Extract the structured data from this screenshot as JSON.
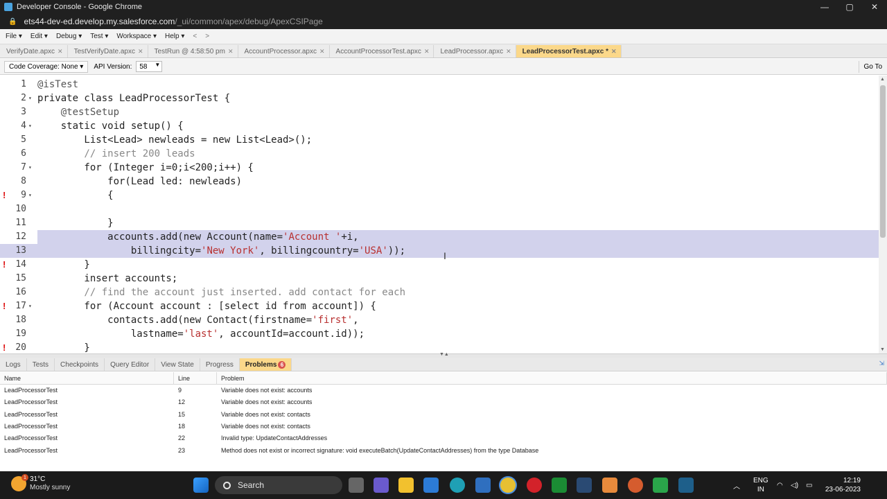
{
  "window": {
    "title": "Developer Console - Google Chrome"
  },
  "url": {
    "host": "ets44-dev-ed.develop.my.salesforce.com",
    "path": "/_ui/common/apex/debug/ApexCSIPage"
  },
  "menu": {
    "items": [
      "File ▾",
      "Edit ▾",
      "Debug ▾",
      "Test ▾",
      "Workspace ▾",
      "Help ▾"
    ],
    "back": "<",
    "forward": ">"
  },
  "tabs": [
    {
      "label": "VerifyDate.apxc",
      "active": false
    },
    {
      "label": "TestVerifyDate.apxc",
      "active": false
    },
    {
      "label": "TestRun @ 4:58:50 pm",
      "active": false
    },
    {
      "label": "AccountProcessor.apxc",
      "active": false
    },
    {
      "label": "AccountProcessorTest.apxc",
      "active": false
    },
    {
      "label": "LeadProcessor.apxc",
      "active": false
    },
    {
      "label": "LeadProcessorTest.apxc *",
      "active": true
    }
  ],
  "toolbar": {
    "code_coverage": "Code Coverage: None ▾",
    "api_label": "API Version:",
    "api_value": "58",
    "goto": "Go To"
  },
  "code": [
    {
      "n": "1",
      "err": "",
      "fold": "",
      "text": "@isTest"
    },
    {
      "n": "2",
      "err": "",
      "fold": "▾",
      "text": "private class LeadProcessorTest {"
    },
    {
      "n": "3",
      "err": "",
      "fold": "",
      "text": "    @testSetup"
    },
    {
      "n": "4",
      "err": "",
      "fold": "▾",
      "text": "    static void setup() {"
    },
    {
      "n": "5",
      "err": "",
      "fold": "",
      "text": "        List<Lead> newleads = new List<Lead>();"
    },
    {
      "n": "6",
      "err": "",
      "fold": "",
      "text": "        // insert 200 leads"
    },
    {
      "n": "7",
      "err": "",
      "fold": "▾",
      "text": "        for (Integer i=0;i<200;i++) {"
    },
    {
      "n": "8",
      "err": "",
      "fold": "",
      "text": "            for(Lead led: newleads)"
    },
    {
      "n": "9",
      "err": "!",
      "fold": "▾",
      "text": "            {"
    },
    {
      "n": "10",
      "err": "",
      "fold": "",
      "text": ""
    },
    {
      "n": "11",
      "err": "",
      "fold": "",
      "text": "            }"
    },
    {
      "n": "12",
      "err": "",
      "fold": "",
      "text": "            accounts.add(new Account(name='Account '+i,"
    },
    {
      "n": "13",
      "err": "",
      "fold": "",
      "text": "                billingcity='New York', billingcountry='USA'));"
    },
    {
      "n": "14",
      "err": "!",
      "fold": "",
      "text": "        }"
    },
    {
      "n": "15",
      "err": "",
      "fold": "",
      "text": "        insert accounts;"
    },
    {
      "n": "16",
      "err": "",
      "fold": "",
      "text": "        // find the account just inserted. add contact for each"
    },
    {
      "n": "17",
      "err": "!",
      "fold": "▾",
      "text": "        for (Account account : [select id from account]) {"
    },
    {
      "n": "18",
      "err": "",
      "fold": "",
      "text": "            contacts.add(new Contact(firstname='first',"
    },
    {
      "n": "19",
      "err": "",
      "fold": "",
      "text": "                lastname='last', accountId=account.id));"
    },
    {
      "n": "20",
      "err": "!",
      "fold": "",
      "text": "        }"
    }
  ],
  "panel_tabs": [
    "Logs",
    "Tests",
    "Checkpoints",
    "Query Editor",
    "View State",
    "Progress",
    "Problems"
  ],
  "problems_badge": "6",
  "grid": {
    "headers": {
      "name": "Name",
      "line": "Line",
      "problem": "Problem"
    },
    "rows": [
      {
        "name": "LeadProcessorTest",
        "line": "9",
        "problem": "Variable does not exist: accounts"
      },
      {
        "name": "LeadProcessorTest",
        "line": "12",
        "problem": "Variable does not exist: accounts"
      },
      {
        "name": "LeadProcessorTest",
        "line": "15",
        "problem": "Variable does not exist: contacts"
      },
      {
        "name": "LeadProcessorTest",
        "line": "18",
        "problem": "Variable does not exist: contacts"
      },
      {
        "name": "LeadProcessorTest",
        "line": "22",
        "problem": "Invalid type: UpdateContactAddresses"
      },
      {
        "name": "LeadProcessorTest",
        "line": "23",
        "problem": "Method does not exist or incorrect signature: void executeBatch(UpdateContactAddresses) from the type Database"
      }
    ]
  },
  "taskbar": {
    "weather_badge": "1",
    "temp": "31°C",
    "condition": "Mostly sunny",
    "search": "Search",
    "lang1": "ENG",
    "lang2": "IN",
    "time": "12:19",
    "date": "23-06-2023"
  },
  "colors": {
    "active_tab": "#fbd88a",
    "selection": "#d2d2ec",
    "error": "#d11111",
    "string": "#b83030",
    "comment": "#888888"
  }
}
